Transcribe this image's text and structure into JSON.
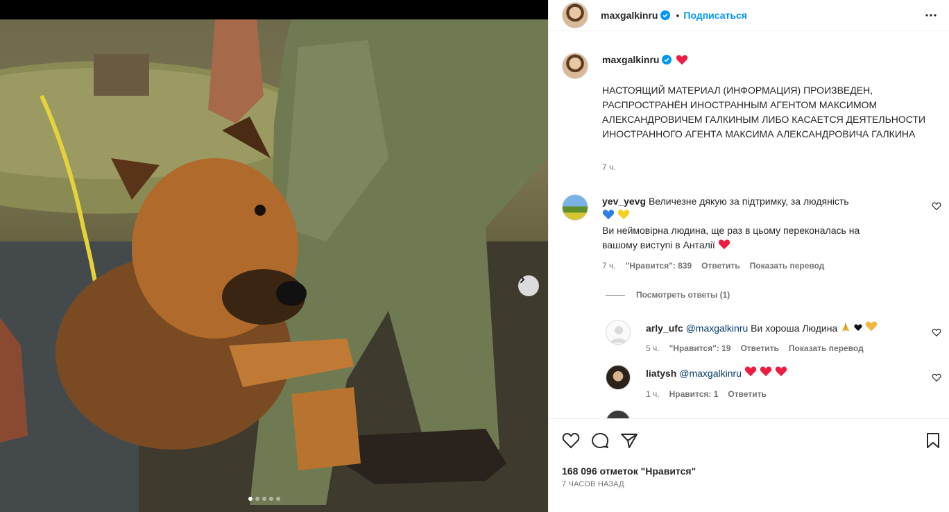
{
  "post_owner": {
    "username": "maxgalkinru",
    "follow_label": "Подписаться",
    "separator": "•"
  },
  "caption": {
    "username": "maxgalkinru",
    "text": "НАСТОЯЩИЙ МАТЕРИАЛ (ИНФОРМАЦИЯ) ПРОИЗВЕДЕН, РАСПРОСТРАНЁН ИНОСТРАННЫМ АГЕНТОМ МАКСИМОМ АЛЕКСАНДРОВИЧЕМ ГАЛКИНЫМ ЛИБО КАСАЕТСЯ ДЕЯТЕЛЬНОСТИ ИНОСТРАННОГО АГЕНТА МАКСИМА АЛЕКСАНДРОВИЧА ГАЛКИНА",
    "time": "7 ч."
  },
  "comments": [
    {
      "username": "yev_yevg",
      "text1": "Величезне дякую за підтримку, за людяність",
      "text2": "Ви неймовірна людина, ще раз в цьому переконалась на вашому виступі в Анталії",
      "time": "7 ч.",
      "likes": "\"Нравится\": 839",
      "reply": "Ответить",
      "translate": "Показать перевод",
      "view_replies": "Посмотреть ответы (1)"
    },
    {
      "username": "arly_ufc",
      "mention": "@maxgalkinru",
      "text": "Ви хороша Людина",
      "time": "5 ч.",
      "likes": "\"Нравится\": 19",
      "reply": "Ответить",
      "translate": "Показать перевод"
    },
    {
      "username": "liatysh",
      "mention": "@maxgalkinru",
      "time": "1 ч.",
      "likes": "Нравится: 1",
      "reply": "Ответить"
    }
  ],
  "footer": {
    "likes_count": "168 096 отметок \"Нравится\"",
    "time_ago": "7 ЧАСОВ НАЗАД"
  },
  "carousel": {
    "slides": 5,
    "active": 1
  },
  "colors": {
    "accent": "#0095f6",
    "heart": "#ed1c40",
    "text": "#262626",
    "muted": "#737373"
  }
}
